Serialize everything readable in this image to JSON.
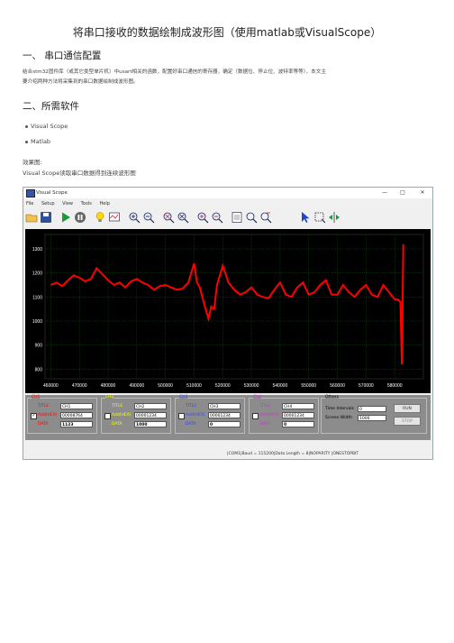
{
  "doc": {
    "title": "将串口接收的数据绘制成波形图（使用matlab或VisualScope）",
    "section1": "一、 串口通信配置",
    "para1a": "结合stm32固件库（或其它类型单片机）中usart相关的函数，配置好串口通信的寄存器，确定（数据位、停止位、波特率等等），本文主",
    "para1b": "要介绍两种方法将采集到的串口数据绘制成波形图。",
    "section2": "二、所需软件",
    "bullets": [
      "Visual Scope",
      "Matlab"
    ],
    "effect_label": "效果图:",
    "caption": "Visual Scope读取串口数据得到连续波形图"
  },
  "app": {
    "window_title": "Visual Scope",
    "window_controls": [
      "—",
      "□",
      "✕"
    ],
    "menu": [
      "File",
      "Setup",
      "View",
      "Tools",
      "Help"
    ],
    "toolbar_icons": [
      "open-icon",
      "save-icon",
      "run-icon",
      "stop-icon",
      "bulb-icon",
      "scope-icon",
      "zoom-in-icon",
      "zoom-out-icon",
      "zoom-x-in-icon",
      "zoom-x-out-icon",
      "zoom-y-in-icon",
      "zoom-y-out-icon",
      "fit-icon",
      "search-icon",
      "cursor-icon",
      "select-icon",
      "measure-icon"
    ],
    "channels": [
      {
        "header": "CH1",
        "title_label": "TITLE",
        "title": "CH1",
        "addr_label": "Add(HEX)",
        "addr": "00008764",
        "data_label": "DATA",
        "data": "1123",
        "color": "#ff0000",
        "checked": true
      },
      {
        "header": "CH2",
        "title_label": "TITLE",
        "title": "CH2",
        "addr_label": "Add(HEX)",
        "addr": "00001234",
        "data_label": "DATA",
        "data": "1000",
        "color": "#ffff00",
        "checked": false
      },
      {
        "header": "CH3",
        "title_label": "TITLE",
        "title": "CH3",
        "addr_label": "Add(HEX)",
        "addr": "00001234",
        "data_label": "DATA",
        "data": "0",
        "color": "#3344ff",
        "checked": false
      },
      {
        "header": "CH4",
        "title_label": "TITLE",
        "title": "CH4",
        "addr_label": "Add(HEX)",
        "addr": "00001234",
        "data_label": "DATA",
        "data": "0",
        "color": "#cc33cc",
        "checked": false
      }
    ],
    "others": {
      "header": "Others",
      "time_interval_label": "Time Intervals",
      "time_interval": "0",
      "screen_width_label": "Screen Width",
      "screen_width": "1000",
      "run_label": "RUN",
      "stop_label": "STOP"
    },
    "status": "|COM1|Baud = 115200|Data Length = 8|NOPARITY  |ONESTOPBIT"
  },
  "chart_data": {
    "type": "line",
    "title": "",
    "xlabel": "",
    "ylabel": "",
    "xlim": [
      458000,
      590000
    ],
    "ylim": [
      760,
      1360
    ],
    "x_ticks": [
      460000,
      470000,
      480000,
      490000,
      500000,
      510000,
      520000,
      530000,
      540000,
      550000,
      560000,
      570000,
      580000
    ],
    "y_ticks": [
      800,
      900,
      1000,
      1100,
      1200,
      1300
    ],
    "grid": true,
    "series": [
      {
        "color": "#ff0000",
        "x": [
          460000,
          462000,
          464000,
          466000,
          468000,
          470000,
          472000,
          474000,
          476000,
          478000,
          480000,
          482000,
          484000,
          486000,
          488000,
          490000,
          492000,
          494000,
          496000,
          498000,
          500000,
          502000,
          504000,
          506000,
          508000,
          510000,
          511000,
          512000,
          514000,
          515000,
          516000,
          517000,
          518000,
          520000,
          522000,
          524000,
          526000,
          528000,
          530000,
          532000,
          534000,
          536000,
          538000,
          540000,
          542000,
          544000,
          546000,
          548000,
          550000,
          552000,
          554000,
          556000,
          558000,
          560000,
          562000,
          564000,
          566000,
          568000,
          570000,
          572000,
          574000,
          576000,
          578000,
          580000,
          581000,
          582000,
          582500,
          583000
        ],
        "y": [
          1150,
          1160,
          1145,
          1170,
          1190,
          1180,
          1165,
          1175,
          1220,
          1195,
          1170,
          1150,
          1160,
          1140,
          1165,
          1175,
          1160,
          1150,
          1130,
          1145,
          1150,
          1140,
          1130,
          1135,
          1160,
          1240,
          1160,
          1140,
          1050,
          1010,
          1060,
          1050,
          1150,
          1230,
          1160,
          1130,
          1110,
          1120,
          1140,
          1110,
          1100,
          1095,
          1130,
          1160,
          1110,
          1100,
          1140,
          1160,
          1110,
          1120,
          1150,
          1170,
          1110,
          1110,
          1150,
          1120,
          1100,
          1130,
          1150,
          1110,
          1100,
          1150,
          1120,
          1090,
          1090,
          1080,
          820,
          1320
        ]
      }
    ]
  }
}
